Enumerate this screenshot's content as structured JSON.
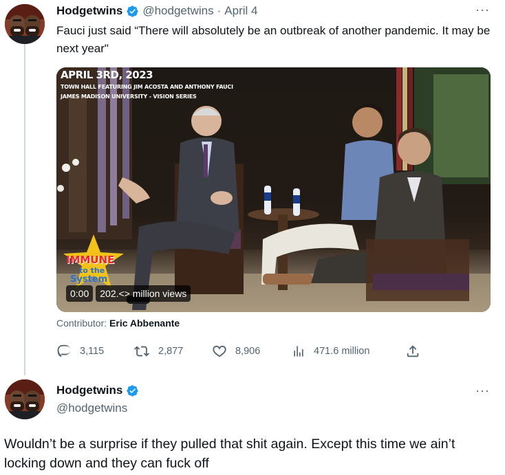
{
  "tweet": {
    "author_name": "Hodgetwins",
    "handle": "@hodgetwins",
    "separator": "·",
    "date": "April 4",
    "more": "···",
    "text": "Fauci just said “There will absolutely be an outbreak of another pandemic. It may be next year\"",
    "media": {
      "overlay_title": "APRIL 3RD, 2023",
      "overlay_line1": "TOWN HALL FEATURING JIM ACOSTA AND ANTHONY FAUCI",
      "overlay_line2": "JAMES MADISON UNIVERSITY - VISION SERIES",
      "badge_word1": "IMMUNE",
      "badge_word2": "to the",
      "badge_word3": "System",
      "time": "0:00",
      "views": "202.<> million views"
    },
    "contributor_label": "Contributor:",
    "contributor_name": "Eric Abbenante",
    "actions": {
      "replies": "3,115",
      "retweets": "2,877",
      "likes": "8,906",
      "views": "471.6 million"
    },
    "icons": {
      "verified": "verified-badge-icon",
      "reply": "reply-icon",
      "retweet": "retweet-icon",
      "like": "heart-icon",
      "views": "analytics-icon",
      "share": "share-icon",
      "more": "more-icon"
    }
  },
  "reply": {
    "author_name": "Hodgetwins",
    "handle": "@hodgetwins",
    "more": "···",
    "text": "Wouldn’t be a surprise if they pulled that shit again. Except this time we ain’t locking down and they can fuck off"
  },
  "colors": {
    "accent": "#1d9bf0",
    "secondary_text": "#536471",
    "primary_text": "#0f1419",
    "thread_line": "#cfd9de"
  }
}
